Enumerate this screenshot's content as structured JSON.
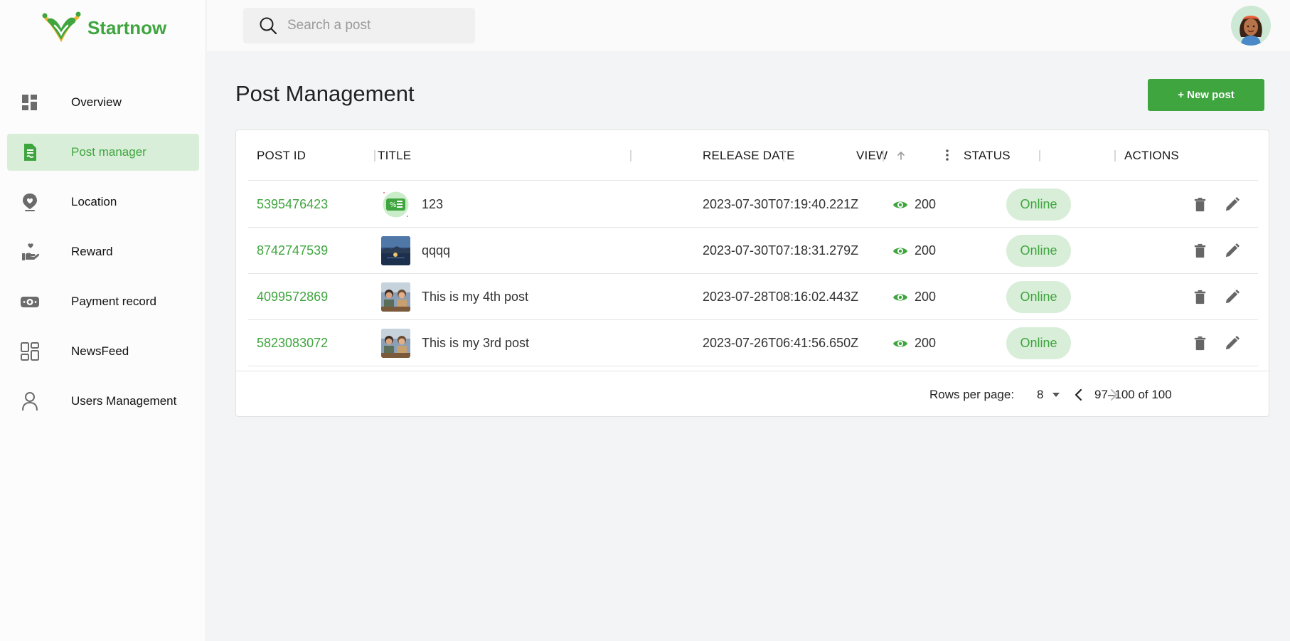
{
  "brand": {
    "name": "Startnow"
  },
  "nav": [
    {
      "label": "Overview",
      "icon": "dashboard-icon",
      "active": false
    },
    {
      "label": "Post manager",
      "icon": "document-icon",
      "active": true
    },
    {
      "label": "Location",
      "icon": "location-pin-icon",
      "active": false
    },
    {
      "label": "Reward",
      "icon": "hand-heart-icon",
      "active": false
    },
    {
      "label": "Payment record",
      "icon": "cash-icon",
      "active": false
    },
    {
      "label": "NewsFeed",
      "icon": "grid-icon",
      "active": false
    },
    {
      "label": "Users Management",
      "icon": "user-icon",
      "active": false
    }
  ],
  "search": {
    "placeholder": "Search a post",
    "value": ""
  },
  "page": {
    "title": "Post Management",
    "new_post_label": "+ New post"
  },
  "table": {
    "columns": {
      "post_id": "POST ID",
      "title": "TITLE",
      "release_date": "RELEASE DATE",
      "view": "VIEW",
      "status": "STATUS",
      "actions": "ACTIONS"
    },
    "sort": {
      "column": "view",
      "direction": "ascending"
    },
    "rows": [
      {
        "id": "5395476423",
        "title": "123",
        "thumb": "coupon",
        "release_date": "2023-07-30T07:19:40.221Z",
        "views": "200",
        "status": "Online"
      },
      {
        "id": "8742747539",
        "title": "qqqq",
        "thumb": "harbor",
        "release_date": "2023-07-30T07:18:31.279Z",
        "views": "200",
        "status": "Online"
      },
      {
        "id": "4099572869",
        "title": "This is my 4th post",
        "thumb": "people",
        "release_date": "2023-07-28T08:16:02.443Z",
        "views": "200",
        "status": "Online"
      },
      {
        "id": "5823083072",
        "title": "This is my 3rd post",
        "thumb": "people",
        "release_date": "2023-07-26T06:41:56.650Z",
        "views": "200",
        "status": "Online"
      }
    ]
  },
  "pagination": {
    "rows_per_page_label": "Rows per page:",
    "rows_per_page": "8",
    "range": "97–100 of 100"
  },
  "colors": {
    "brand_green": "#3fa53f",
    "active_bg": "#d8eed8",
    "background": "#f3f4f6"
  }
}
